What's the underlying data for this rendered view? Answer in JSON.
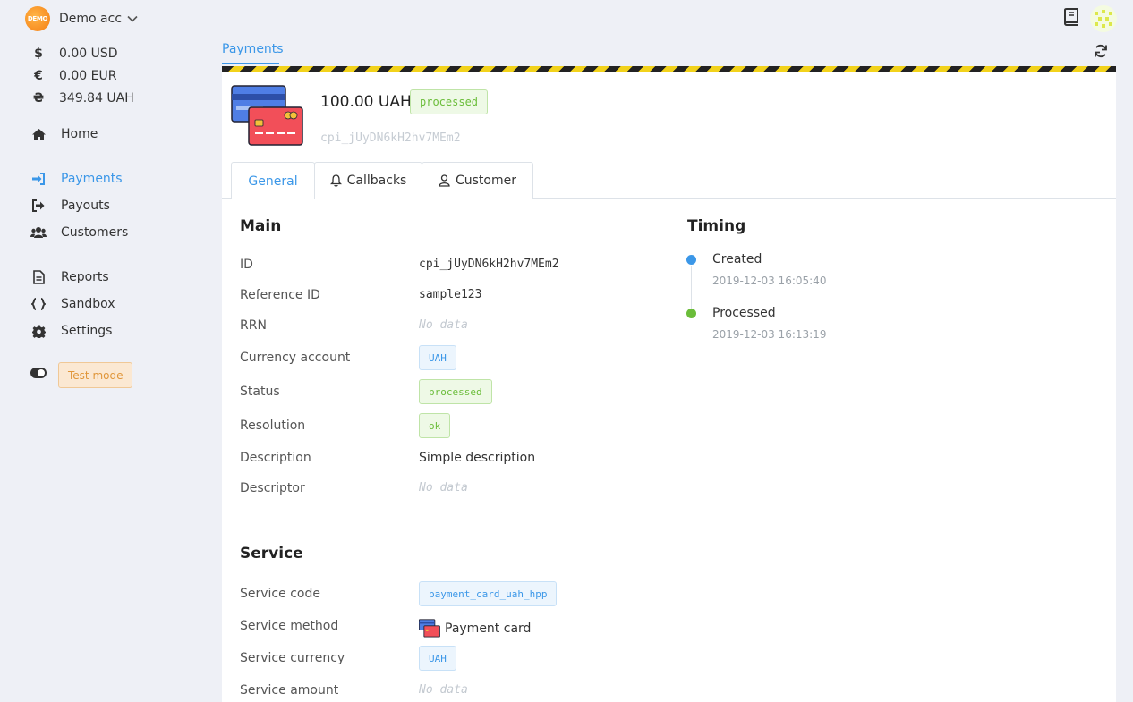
{
  "account": {
    "badge": "DEMO",
    "name": "Demo acc"
  },
  "balances": [
    {
      "symbol": "$",
      "amount": "0.00 USD"
    },
    {
      "symbol": "€",
      "amount": "0.00 EUR"
    },
    {
      "symbol": "₴",
      "amount": "349.84 UAH"
    }
  ],
  "nav": {
    "home": "Home",
    "payments": "Payments",
    "payouts": "Payouts",
    "customers": "Customers",
    "reports": "Reports",
    "sandbox": "Sandbox",
    "settings": "Settings"
  },
  "test_mode_label": "Test mode",
  "breadcrumb": "Payments",
  "payment": {
    "amount": "100.00 UAH",
    "status": "processed",
    "id": "cpi_jUyDN6kH2hv7MEm2"
  },
  "tabs": {
    "general": "General",
    "callbacks": "Callbacks",
    "customer": "Customer"
  },
  "main": {
    "title": "Main",
    "labels": {
      "id": "ID",
      "reference_id": "Reference ID",
      "rrn": "RRN",
      "currency_account": "Currency account",
      "status": "Status",
      "resolution": "Resolution",
      "description": "Description",
      "descriptor": "Descriptor"
    },
    "values": {
      "id": "cpi_jUyDN6kH2hv7MEm2",
      "reference_id": "sample123",
      "rrn": "No data",
      "currency_account": "UAH",
      "status": "processed",
      "resolution": "ok",
      "description": "Simple description",
      "descriptor": "No data"
    }
  },
  "timing": {
    "title": "Timing",
    "events": [
      {
        "label": "Created",
        "time": "2019-12-03 16:05:40"
      },
      {
        "label": "Processed",
        "time": "2019-12-03 16:13:19"
      }
    ]
  },
  "service": {
    "title": "Service",
    "labels": {
      "code": "Service code",
      "method": "Service method",
      "currency": "Service currency",
      "amount": "Service amount"
    },
    "values": {
      "code": "payment_card_uah_hpp",
      "method": "Payment card",
      "currency": "UAH",
      "amount": "No data"
    }
  },
  "colors": {
    "accent": "#3b97e8",
    "success": "#6bbd3a",
    "warning": "#e0963a"
  }
}
